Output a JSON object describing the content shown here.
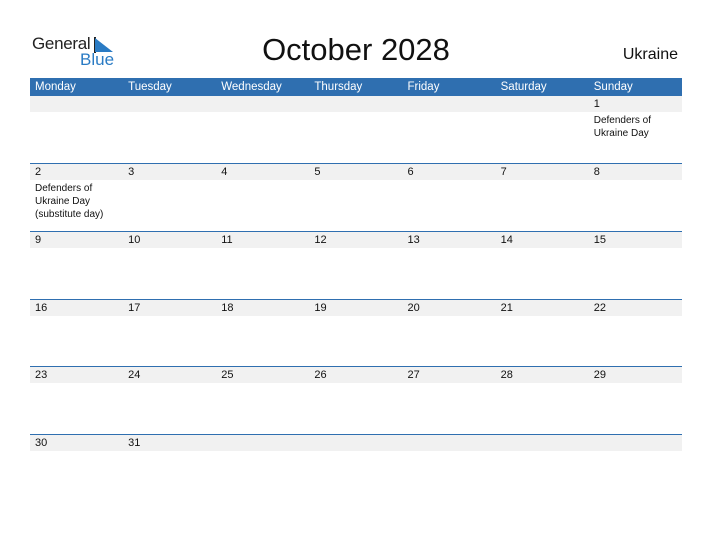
{
  "logo": {
    "word1": "General",
    "word2": "Blue"
  },
  "title": "October 2028",
  "country": "Ukraine",
  "weekdays": [
    "Monday",
    "Tuesday",
    "Wednesday",
    "Thursday",
    "Friday",
    "Saturday",
    "Sunday"
  ],
  "weeks": [
    {
      "days": [
        "",
        "",
        "",
        "",
        "",
        "",
        "1"
      ],
      "events": [
        "",
        "",
        "",
        "",
        "",
        "",
        "Defenders of Ukraine Day"
      ]
    },
    {
      "days": [
        "2",
        "3",
        "4",
        "5",
        "6",
        "7",
        "8"
      ],
      "events": [
        "Defenders of Ukraine Day (substitute day)",
        "",
        "",
        "",
        "",
        "",
        ""
      ]
    },
    {
      "days": [
        "9",
        "10",
        "11",
        "12",
        "13",
        "14",
        "15"
      ],
      "events": [
        "",
        "",
        "",
        "",
        "",
        "",
        ""
      ]
    },
    {
      "days": [
        "16",
        "17",
        "18",
        "19",
        "20",
        "21",
        "22"
      ],
      "events": [
        "",
        "",
        "",
        "",
        "",
        "",
        ""
      ]
    },
    {
      "days": [
        "23",
        "24",
        "25",
        "26",
        "27",
        "28",
        "29"
      ],
      "events": [
        "",
        "",
        "",
        "",
        "",
        "",
        ""
      ]
    },
    {
      "days": [
        "30",
        "31",
        "",
        "",
        "",
        "",
        ""
      ],
      "events": [
        "",
        "",
        "",
        "",
        "",
        "",
        ""
      ]
    }
  ],
  "colors": {
    "accent": "#2f6fb0",
    "logo_blue": "#2a7bc4",
    "day_strip": "#f1f1f1"
  }
}
